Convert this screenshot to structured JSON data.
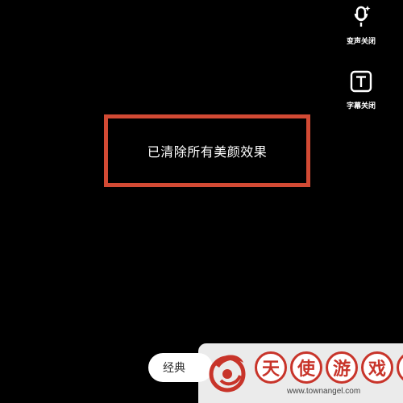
{
  "tools": {
    "voice_change": {
      "label": "变声关闭",
      "icon": "mic-sparkle-icon"
    },
    "subtitles": {
      "label": "字幕关闭",
      "icon": "text-t-icon"
    }
  },
  "toast": {
    "message": "已清除所有美颜效果",
    "highlight_color": "#d24a34"
  },
  "mode_button": {
    "label": "经典"
  },
  "watermark": {
    "chars": [
      "天",
      "使",
      "游",
      "戏",
      "网"
    ],
    "url": "www.townangel.com",
    "color": "#c8342a"
  }
}
